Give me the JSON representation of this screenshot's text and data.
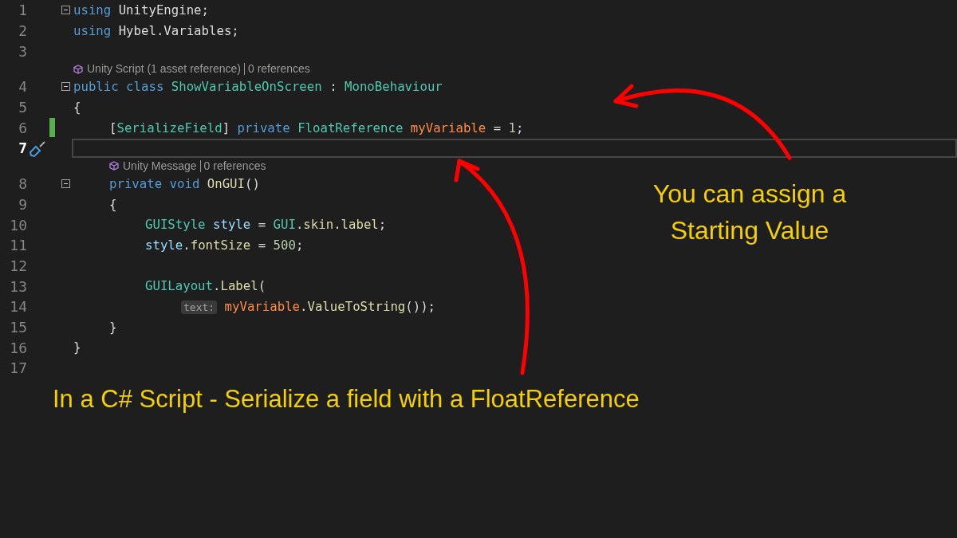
{
  "editor": {
    "rows": [
      {
        "kind": "code",
        "number": "1",
        "current": false,
        "changed": false,
        "collapsible": true,
        "tokens": [
          {
            "kind": "keyword",
            "text": "using"
          },
          {
            "kind": "space"
          },
          {
            "kind": "plain",
            "text": "UnityEngine;"
          }
        ]
      },
      {
        "kind": "code",
        "number": "2",
        "current": false,
        "changed": false,
        "collapsible": false,
        "tokens": [
          {
            "kind": "keyword",
            "text": "using"
          },
          {
            "kind": "space"
          },
          {
            "kind": "plain",
            "text": "Hybel.Variables;"
          }
        ]
      },
      {
        "kind": "code",
        "number": "3",
        "current": false,
        "changed": false,
        "collapsible": false,
        "tokens": []
      },
      {
        "kind": "codelens",
        "items": [
          "Unity Script (1 asset reference)",
          "0 references"
        ]
      },
      {
        "kind": "code",
        "number": "4",
        "current": false,
        "changed": false,
        "collapsible": true,
        "tokens": [
          {
            "kind": "keyword",
            "text": "public class"
          },
          {
            "kind": "space"
          },
          {
            "kind": "type",
            "text": "ShowVariableOnScreen"
          },
          {
            "kind": "space"
          },
          {
            "kind": "plain",
            "text": ":"
          },
          {
            "kind": "space"
          },
          {
            "kind": "type",
            "text": "MonoBehaviour"
          }
        ]
      },
      {
        "kind": "code",
        "number": "5",
        "current": false,
        "changed": false,
        "collapsible": false,
        "tokens": [
          {
            "kind": "plain",
            "text": "{"
          }
        ]
      },
      {
        "kind": "code",
        "number": "6",
        "current": false,
        "changed": true,
        "collapsible": false,
        "tokens": [
          {
            "kind": "indent"
          },
          {
            "kind": "plain",
            "text": "["
          },
          {
            "kind": "type",
            "text": "SerializeField"
          },
          {
            "kind": "plain",
            "text": "]"
          },
          {
            "kind": "space"
          },
          {
            "kind": "keyword",
            "text": "private"
          },
          {
            "kind": "space"
          },
          {
            "kind": "type",
            "text": "FloatReference"
          },
          {
            "kind": "space"
          },
          {
            "kind": "field",
            "text": "myVariable"
          },
          {
            "kind": "space"
          },
          {
            "kind": "plain",
            "text": "="
          },
          {
            "kind": "space"
          },
          {
            "kind": "number",
            "text": "1"
          },
          {
            "kind": "plain",
            "text": ";"
          }
        ]
      },
      {
        "kind": "code",
        "number": "7",
        "current": true,
        "changed": false,
        "collapsible": false,
        "tokens": []
      },
      {
        "kind": "codelens",
        "tokens": [
          {
            "kind": "indent"
          }
        ],
        "items": [
          "Unity Message",
          "0 references"
        ]
      },
      {
        "kind": "code",
        "number": "8",
        "current": false,
        "changed": false,
        "collapsible": true,
        "tokens": [
          {
            "kind": "indent"
          },
          {
            "kind": "keyword",
            "text": "private void"
          },
          {
            "kind": "space"
          },
          {
            "kind": "method",
            "text": "OnGUI"
          },
          {
            "kind": "plain",
            "text": "()"
          }
        ]
      },
      {
        "kind": "code",
        "number": "9",
        "current": false,
        "changed": false,
        "collapsible": false,
        "tokens": [
          {
            "kind": "indent"
          },
          {
            "kind": "plain",
            "text": "{"
          }
        ]
      },
      {
        "kind": "code",
        "number": "10",
        "current": false,
        "changed": false,
        "collapsible": false,
        "tokens": [
          {
            "kind": "indent"
          },
          {
            "kind": "indent"
          },
          {
            "kind": "type",
            "text": "GUIStyle"
          },
          {
            "kind": "space"
          },
          {
            "kind": "local",
            "text": "style"
          },
          {
            "kind": "space"
          },
          {
            "kind": "plain",
            "text": "="
          },
          {
            "kind": "space"
          },
          {
            "kind": "type",
            "text": "GUI"
          },
          {
            "kind": "plain",
            "text": "."
          },
          {
            "kind": "method",
            "text": "skin"
          },
          {
            "kind": "plain",
            "text": "."
          },
          {
            "kind": "method",
            "text": "label"
          },
          {
            "kind": "plain",
            "text": ";"
          }
        ]
      },
      {
        "kind": "code",
        "number": "11",
        "current": false,
        "changed": false,
        "collapsible": false,
        "tokens": [
          {
            "kind": "indent"
          },
          {
            "kind": "indent"
          },
          {
            "kind": "local",
            "text": "style"
          },
          {
            "kind": "plain",
            "text": "."
          },
          {
            "kind": "method",
            "text": "fontSize"
          },
          {
            "kind": "space"
          },
          {
            "kind": "plain",
            "text": "="
          },
          {
            "kind": "space"
          },
          {
            "kind": "number",
            "text": "500"
          },
          {
            "kind": "plain",
            "text": ";"
          }
        ]
      },
      {
        "kind": "code",
        "number": "12",
        "current": false,
        "changed": false,
        "collapsible": false,
        "tokens": []
      },
      {
        "kind": "code",
        "number": "13",
        "current": false,
        "changed": false,
        "collapsible": false,
        "tokens": [
          {
            "kind": "indent"
          },
          {
            "kind": "indent"
          },
          {
            "kind": "type",
            "text": "GUILayout"
          },
          {
            "kind": "plain",
            "text": "."
          },
          {
            "kind": "method",
            "text": "Label"
          },
          {
            "kind": "plain",
            "text": "("
          }
        ]
      },
      {
        "kind": "code",
        "number": "14",
        "current": false,
        "changed": false,
        "collapsible": false,
        "tokens": [
          {
            "kind": "indent"
          },
          {
            "kind": "indent"
          },
          {
            "kind": "indent"
          },
          {
            "kind": "hint",
            "text": "text:"
          },
          {
            "kind": "space"
          },
          {
            "kind": "field",
            "text": "myVariable"
          },
          {
            "kind": "plain",
            "text": "."
          },
          {
            "kind": "method",
            "text": "ValueToString"
          },
          {
            "kind": "plain",
            "text": "());"
          }
        ]
      },
      {
        "kind": "code",
        "number": "15",
        "current": false,
        "changed": false,
        "collapsible": false,
        "tokens": [
          {
            "kind": "indent"
          },
          {
            "kind": "plain",
            "text": "}"
          }
        ]
      },
      {
        "kind": "code",
        "number": "16",
        "current": false,
        "changed": false,
        "collapsible": false,
        "tokens": [
          {
            "kind": "plain",
            "text": "}"
          }
        ]
      },
      {
        "kind": "code",
        "number": "17",
        "current": false,
        "changed": false,
        "collapsible": false,
        "tokens": []
      }
    ]
  },
  "annotations": {
    "side_note": [
      "You can assign a",
      "Starting Value"
    ],
    "caption": "In a C# Script - Serialize a field with a FloatReference"
  }
}
